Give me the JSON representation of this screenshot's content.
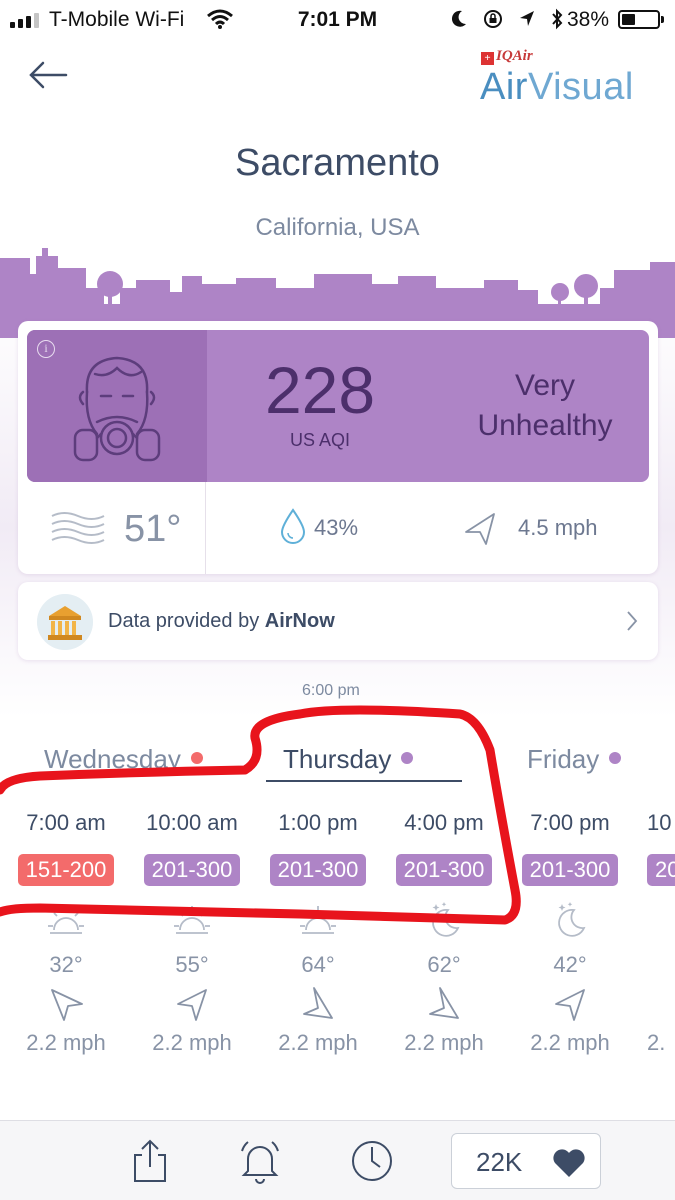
{
  "status_bar": {
    "carrier": "T-Mobile Wi-Fi",
    "time": "7:01 PM",
    "battery": "38%"
  },
  "brand": {
    "parent": "IQAir",
    "name_part1": "Air",
    "name_part2": "Visual"
  },
  "location": {
    "city": "Sacramento",
    "region": "California, USA"
  },
  "aqi": {
    "value": "228",
    "unit": "US AQI",
    "status_line1": "Very",
    "status_line2": "Unhealthy",
    "color": "#ae84c6"
  },
  "weather": {
    "temperature": "51°",
    "humidity": "43%",
    "wind": "4.5 mph"
  },
  "provider": {
    "prefix": "Data provided by ",
    "name": "AirNow"
  },
  "forecast": {
    "updated_time": "6:00 pm",
    "days": [
      {
        "label": "Wednesday",
        "dot_color": "#f36b6b",
        "active": false
      },
      {
        "label": "Thursday",
        "dot_color": "#ae84c6",
        "active": true
      },
      {
        "label": "Friday",
        "dot_color": "#ae84c6",
        "active": false
      }
    ],
    "hours": [
      {
        "time": "7:00 am",
        "aqi": "151-200",
        "aqi_color": "#f36b6b",
        "icon": "sun-icon",
        "temp": "32°",
        "wind": "2.2 mph"
      },
      {
        "time": "10:00 am",
        "aqi": "201-300",
        "aqi_color": "#ae84c6",
        "icon": "sun-icon",
        "temp": "55°",
        "wind": "2.2 mph"
      },
      {
        "time": "1:00 pm",
        "aqi": "201-300",
        "aqi_color": "#ae84c6",
        "icon": "sun-icon",
        "temp": "64°",
        "wind": "2.2 mph"
      },
      {
        "time": "4:00 pm",
        "aqi": "201-300",
        "aqi_color": "#ae84c6",
        "icon": "moon-icon",
        "temp": "62°",
        "wind": "2.2 mph"
      },
      {
        "time": "7:00 pm",
        "aqi": "201-300",
        "aqi_color": "#ae84c6",
        "icon": "moon-icon",
        "temp": "42°",
        "wind": "2.2 mph"
      },
      {
        "time": "10",
        "aqi": "20",
        "aqi_color": "#ae84c6",
        "icon": "",
        "temp": "",
        "wind": "2."
      }
    ]
  },
  "bottom_bar": {
    "likes": "22K"
  }
}
